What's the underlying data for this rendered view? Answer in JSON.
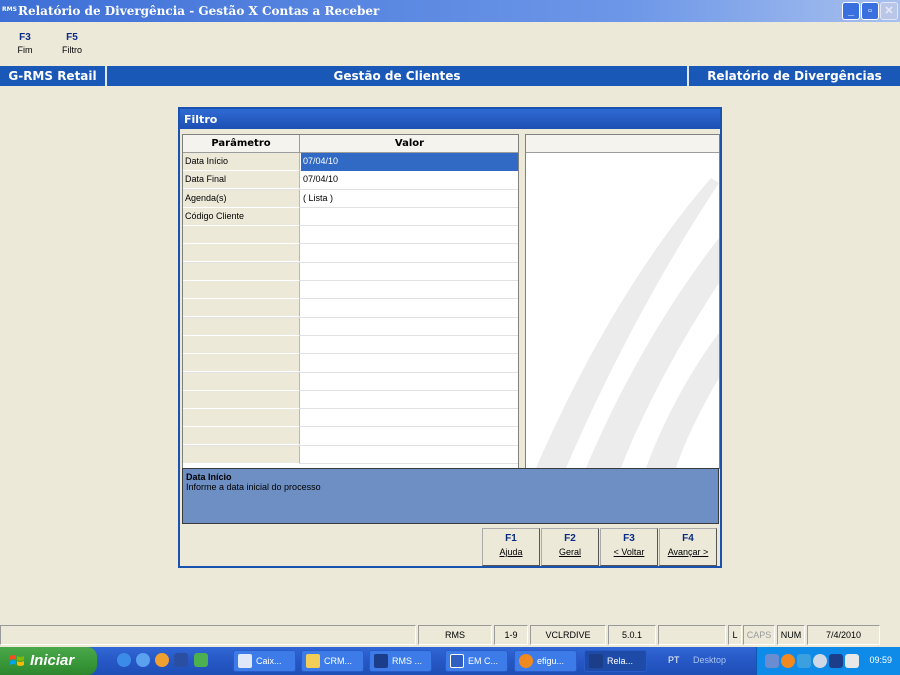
{
  "window": {
    "title": "Relatório de Divergência - Gestão X Contas a Receber",
    "icon_label": "RMS"
  },
  "toolbar": {
    "buttons": [
      {
        "key": "F3",
        "label": "Fim"
      },
      {
        "key": "F5",
        "label": "Filtro"
      }
    ]
  },
  "banner": {
    "left": "G-RMS Retail",
    "center": "Gestão de Clientes",
    "right": "Relatório de Divergências"
  },
  "filter": {
    "title": "Filtro",
    "col_param": "Parâmetro",
    "col_value": "Valor",
    "rows": [
      {
        "param": "Data Início",
        "value": "07/04/10"
      },
      {
        "param": "Data Final",
        "value": "07/04/10"
      },
      {
        "param": "Agenda(s)",
        "value": "( Lista )"
      },
      {
        "param": "Código Cliente",
        "value": ""
      }
    ],
    "help_title": "Data Início",
    "help_text": "Informe a data inicial do processo",
    "fkeys": [
      {
        "key": "F1",
        "label": "Ajuda"
      },
      {
        "key": "F2",
        "label": "Geral"
      },
      {
        "key": "F3",
        "label": "< Voltar"
      },
      {
        "key": "F4",
        "label": "Avançar >"
      }
    ]
  },
  "statusbar": {
    "app": "RMS",
    "range": "1-9",
    "program": "VCLRDIVE",
    "version": "5.0.1",
    "ind_l": "L",
    "caps": "CAPS",
    "num": "NUM",
    "date": "7/4/2010"
  },
  "taskbar": {
    "start_label": "Iniciar",
    "items": [
      "Caix...",
      "CRM...",
      "RMS ...",
      "EM C...",
      "efigu...",
      "Rela..."
    ],
    "lang": "PT",
    "desktop": "Desktop",
    "clock": "09:59"
  }
}
